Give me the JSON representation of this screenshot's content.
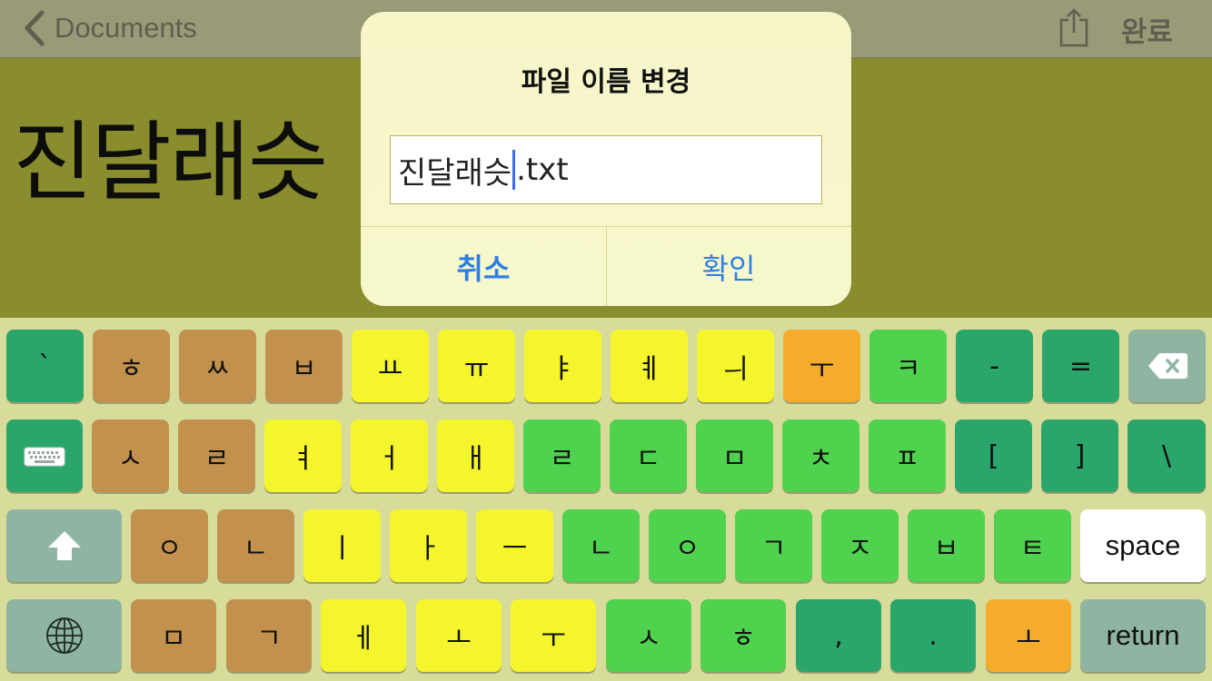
{
  "navbar": {
    "back_label": "Documents",
    "done_label": "완료"
  },
  "document": {
    "text": "진달래슷"
  },
  "dialog": {
    "title": "파일 이름 변경",
    "name_before_caret": "진달래슷",
    "name_after_caret": ".txt",
    "cancel_label": "취소",
    "ok_label": "확인"
  },
  "keyboard": {
    "row1": [
      {
        "label": "`",
        "color": "#2aa66b"
      },
      {
        "label": "ㅎ",
        "color": "#c3914e"
      },
      {
        "label": "ㅆ",
        "color": "#c3914e"
      },
      {
        "label": "ㅂ",
        "color": "#c3914e"
      },
      {
        "label": "ㅛ",
        "color": "#f4f52d"
      },
      {
        "label": "ㅠ",
        "color": "#f4f52d"
      },
      {
        "label": "ㅑ",
        "color": "#f4f52d"
      },
      {
        "label": "ㅖ",
        "color": "#f4f52d"
      },
      {
        "label": "ㅢ",
        "color": "#f4f52d"
      },
      {
        "label": "ㅜ",
        "color": "#f5ab2c"
      },
      {
        "label": "ㅋ",
        "color": "#4fd34e"
      },
      {
        "label": "-",
        "color": "#2aa66b"
      },
      {
        "label": "=",
        "color": "#2aa66b"
      }
    ],
    "row2": [
      {
        "label": "ㅅ",
        "color": "#c3914e"
      },
      {
        "label": "ㄹ",
        "color": "#c3914e"
      },
      {
        "label": "ㅕ",
        "color": "#f4f52d"
      },
      {
        "label": "ㅓ",
        "color": "#f4f52d"
      },
      {
        "label": "ㅐ",
        "color": "#f4f52d"
      },
      {
        "label": "ㄹ",
        "color": "#4fd34e"
      },
      {
        "label": "ㄷ",
        "color": "#4fd34e"
      },
      {
        "label": "ㅁ",
        "color": "#4fd34e"
      },
      {
        "label": "ㅊ",
        "color": "#4fd34e"
      },
      {
        "label": "ㅍ",
        "color": "#4fd34e"
      },
      {
        "label": "[",
        "color": "#2aa66b"
      },
      {
        "label": "]",
        "color": "#2aa66b"
      },
      {
        "label": "\\",
        "color": "#2aa66b"
      }
    ],
    "row3": [
      {
        "label": "ㅇ",
        "color": "#c3914e"
      },
      {
        "label": "ㄴ",
        "color": "#c3914e"
      },
      {
        "label": "ㅣ",
        "color": "#f4f52d"
      },
      {
        "label": "ㅏ",
        "color": "#f4f52d"
      },
      {
        "label": "ㅡ",
        "color": "#f4f52d"
      },
      {
        "label": "ㄴ",
        "color": "#4fd34e"
      },
      {
        "label": "ㅇ",
        "color": "#4fd34e"
      },
      {
        "label": "ㄱ",
        "color": "#4fd34e"
      },
      {
        "label": "ㅈ",
        "color": "#4fd34e"
      },
      {
        "label": "ㅂ",
        "color": "#4fd34e"
      },
      {
        "label": "ㅌ",
        "color": "#4fd34e"
      }
    ],
    "row4": [
      {
        "label": "ㅁ",
        "color": "#c3914e"
      },
      {
        "label": "ㄱ",
        "color": "#c3914e"
      },
      {
        "label": "ㅔ",
        "color": "#f4f52d"
      },
      {
        "label": "ㅗ",
        "color": "#f4f52d"
      },
      {
        "label": "ㅜ",
        "color": "#f4f52d"
      },
      {
        "label": "ㅅ",
        "color": "#4fd34e"
      },
      {
        "label": "ㅎ",
        "color": "#4fd34e"
      },
      {
        "label": ",",
        "color": "#2aa66b"
      },
      {
        "label": ".",
        "color": "#2aa66b"
      },
      {
        "label": "ㅗ",
        "color": "#f5ab2c"
      }
    ],
    "space_label": "space",
    "return_label": "return",
    "icons": {
      "backspace": "backspace-icon",
      "keyboard": "keyboard-icon",
      "shift": "shift-icon",
      "globe": "globe-icon"
    }
  }
}
